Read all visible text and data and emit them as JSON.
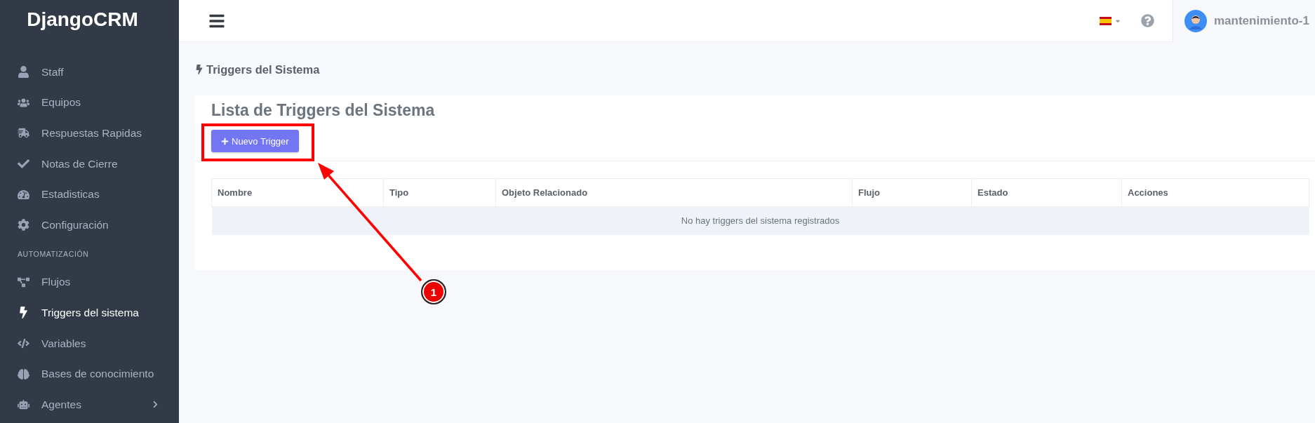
{
  "brand": "DjangoCRM",
  "sidebar": {
    "items": [
      {
        "kind": "link",
        "label": "Staff",
        "selected": false,
        "expandable": false
      },
      {
        "kind": "link",
        "label": "Equipos",
        "selected": false,
        "expandable": false
      },
      {
        "kind": "link",
        "label": "Respuestas Rapidas",
        "selected": false,
        "expandable": false
      },
      {
        "kind": "link",
        "label": "Notas de Cierre",
        "selected": false,
        "expandable": false
      },
      {
        "kind": "link",
        "label": "Estadisticas",
        "selected": false,
        "expandable": false
      },
      {
        "kind": "link",
        "label": "Configuración",
        "selected": false,
        "expandable": false
      },
      {
        "kind": "heading",
        "label": "AUTOMATIZACIÓN"
      },
      {
        "kind": "link",
        "label": "Flujos",
        "selected": false,
        "expandable": false
      },
      {
        "kind": "link",
        "label": "Triggers del sistema",
        "selected": true,
        "expandable": false
      },
      {
        "kind": "link",
        "label": "Variables",
        "selected": false,
        "expandable": false
      },
      {
        "kind": "link",
        "label": "Bases de conocimiento",
        "selected": false,
        "expandable": false
      },
      {
        "kind": "link",
        "label": "Agentes",
        "selected": false,
        "expandable": true
      }
    ]
  },
  "topbar": {
    "user": "mantenimiento-1"
  },
  "page_title": "Triggers del Sistema",
  "card": {
    "title": "Lista de Triggers del Sistema",
    "button": "Nuevo Trigger",
    "table": {
      "columns": [
        "Nombre",
        "Tipo",
        "Objeto Relacionado",
        "Flujo",
        "Estado",
        "Acciones"
      ],
      "empty_message": "No hay triggers del sistema registrados"
    }
  },
  "annotation": {
    "marker": "1"
  }
}
